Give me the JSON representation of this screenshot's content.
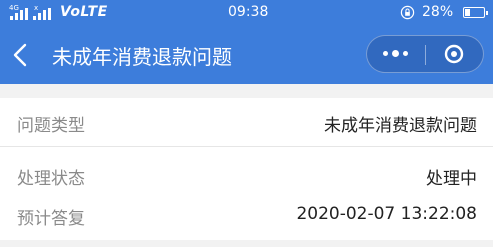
{
  "status_bar": {
    "signal_label_1": "4G",
    "signal_label_2": "x",
    "network": "VoLTE",
    "time": "09:38",
    "battery": "28%"
  },
  "nav": {
    "title": "未成年消费退款问题"
  },
  "details": {
    "rows": [
      {
        "label": "问题类型",
        "value": "未成年消费退款问题"
      },
      {
        "label": "处理状态",
        "value": "处理中"
      },
      {
        "label": "预计答复",
        "value": "2020-02-07 13:22:08"
      }
    ]
  },
  "colors": {
    "header_bg": "#3d7ddb",
    "page_bg": "#f2f2f2",
    "label_text": "#8a8a8a",
    "value_text": "#222222"
  },
  "icons": {
    "back": "chevron-left-icon",
    "more": "more-dots-icon",
    "close": "target-circle-icon",
    "lock": "rotation-lock-icon",
    "battery": "battery-icon"
  }
}
